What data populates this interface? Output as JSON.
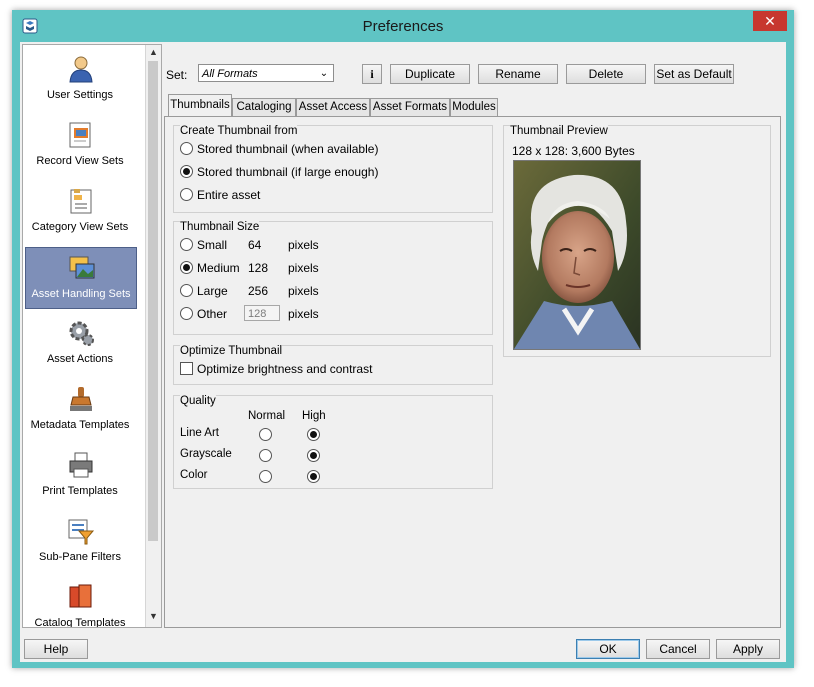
{
  "window": {
    "title": "Preferences",
    "close_glyph": "✕"
  },
  "sidebar": {
    "items": [
      {
        "label": "User Settings",
        "icon": "user-icon"
      },
      {
        "label": "Record View Sets",
        "icon": "record-view-icon"
      },
      {
        "label": "Category View Sets",
        "icon": "category-view-icon"
      },
      {
        "label": "Asset Handling Sets",
        "icon": "asset-handling-icon",
        "selected": true
      },
      {
        "label": "Asset Actions",
        "icon": "gear-icon"
      },
      {
        "label": "Metadata Templates",
        "icon": "stamp-icon"
      },
      {
        "label": "Print Templates",
        "icon": "printer-icon"
      },
      {
        "label": "Sub-Pane Filters",
        "icon": "filter-icon"
      },
      {
        "label": "Catalog Templates",
        "icon": "catalog-icon"
      }
    ]
  },
  "toolbar": {
    "set_label": "Set:",
    "set_value": "All Formats",
    "info_label": "i",
    "duplicate_label": "Duplicate",
    "rename_label": "Rename",
    "delete_label": "Delete",
    "default_label": "Set as Default"
  },
  "tabs": [
    "Thumbnails",
    "Cataloging",
    "Asset Access",
    "Asset Formats",
    "Modules"
  ],
  "create_thumbnail": {
    "title": "Create Thumbnail from",
    "options": [
      "Stored thumbnail (when available)",
      "Stored thumbnail (if large enough)",
      "Entire asset"
    ],
    "selected_index": 1
  },
  "thumbnail_size": {
    "title": "Thumbnail Size",
    "unit": "pixels",
    "options": [
      {
        "label": "Small",
        "value": "64"
      },
      {
        "label": "Medium",
        "value": "128"
      },
      {
        "label": "Large",
        "value": "256"
      },
      {
        "label": "Other",
        "value": "128"
      }
    ],
    "selected_index": 1
  },
  "optimize": {
    "title": "Optimize Thumbnail",
    "checkbox_label": "Optimize brightness and contrast",
    "checked": false
  },
  "quality": {
    "title": "Quality",
    "col_normal": "Normal",
    "col_high": "High",
    "rows": [
      {
        "label": "Line Art",
        "selected": "high"
      },
      {
        "label": "Grayscale",
        "selected": "high"
      },
      {
        "label": "Color",
        "selected": "high"
      }
    ]
  },
  "preview": {
    "title": "Thumbnail Preview",
    "dimensions": "128 x 128: 3,600 Bytes"
  },
  "footer": {
    "help_label": "Help",
    "ok_label": "OK",
    "cancel_label": "Cancel",
    "apply_label": "Apply"
  },
  "colors": {
    "frame": "#5fc4c4",
    "selected_item": "#7e8fb8",
    "close": "#c7372f"
  }
}
